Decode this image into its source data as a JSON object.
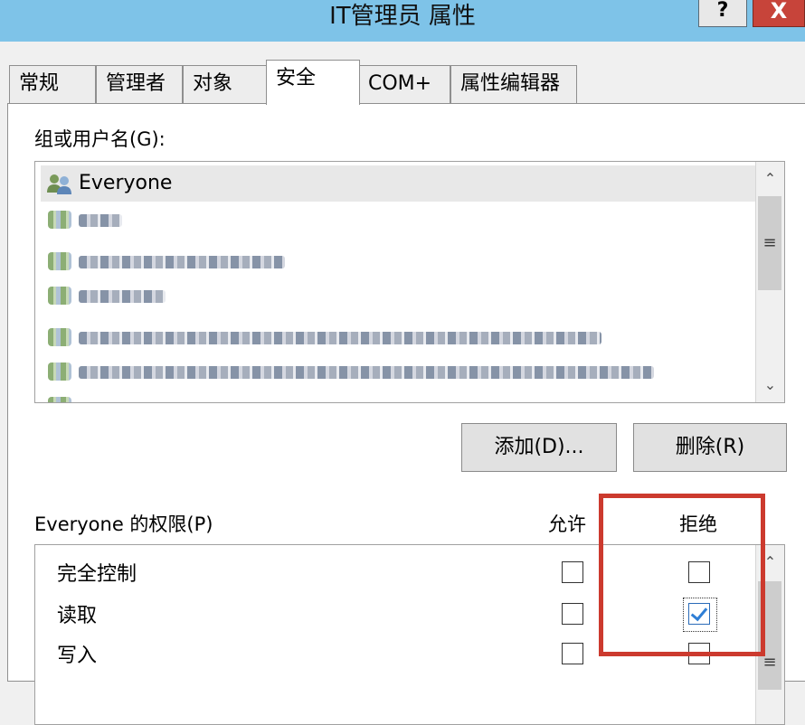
{
  "window": {
    "title": "IT管理员 属性",
    "help_label": "?",
    "close_label": "X"
  },
  "tabs": [
    {
      "label": "常规"
    },
    {
      "label": "管理者"
    },
    {
      "label": "对象"
    },
    {
      "label": "安全"
    },
    {
      "label": "COM+"
    },
    {
      "label": "属性编辑器"
    }
  ],
  "active_tab": "安全",
  "groups": {
    "label": "组或用户名(G):",
    "items": [
      {
        "name": "Everyone",
        "selected": true
      }
    ]
  },
  "buttons": {
    "add": "添加(D)...",
    "remove": "删除(R)"
  },
  "permissions": {
    "label": "Everyone 的权限(P)",
    "allow_header": "允许",
    "deny_header": "拒绝",
    "rows": [
      {
        "name": "完全控制",
        "allow": false,
        "deny": false
      },
      {
        "name": "读取",
        "allow": false,
        "deny": true
      },
      {
        "name": "写入",
        "allow": false,
        "deny": false
      }
    ]
  },
  "scroll": {
    "up_glyph": "⌃",
    "down_glyph": "⌄",
    "grip_glyph": "≡"
  },
  "colors": {
    "titlebar": "#7ec3e8",
    "close_button": "#c7443a",
    "highlight": "#cc3a2e",
    "checkmark": "#2f7fd6"
  }
}
